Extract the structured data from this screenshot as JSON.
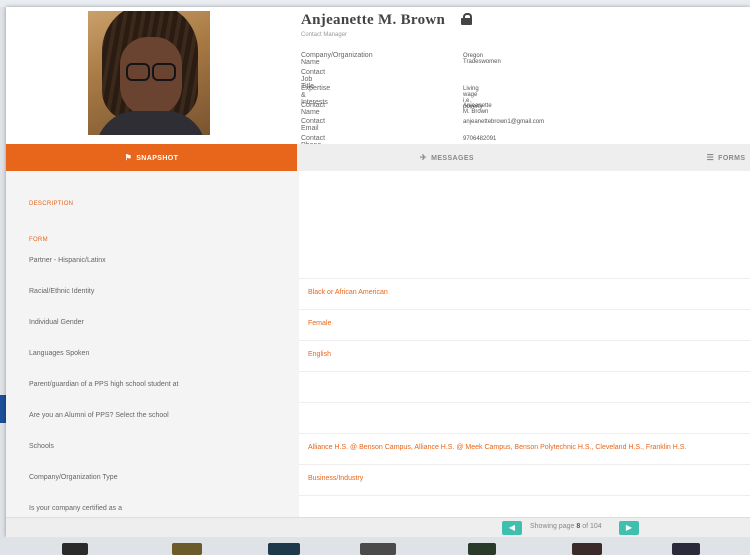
{
  "profile": {
    "name": "Anjeanette M. Brown",
    "role": "Contact Manager",
    "info": [
      {
        "label": "Company/Organization Name",
        "value": "Oregon Tradeswomen"
      },
      {
        "label": "Contact Job Title",
        "value": ""
      },
      {
        "label": "Expertise & Interests",
        "value": "Living wage i.e. poverty"
      },
      {
        "label": "Contact Name",
        "value": "Anjeanette M. Brown"
      },
      {
        "label": "Contact Email",
        "value": "anjeanettebrown1@gmail.com"
      },
      {
        "label": "Contact Phone",
        "value": "9706482091"
      }
    ]
  },
  "tabs": {
    "snapshot": {
      "label": "SNAPSHOT",
      "icon": "⚑"
    },
    "messages": {
      "label": "MESSAGES",
      "icon": "✈"
    },
    "forms": {
      "label": "FORMS",
      "icon": "☰"
    }
  },
  "sections": {
    "description": "DESCRIPTION",
    "form": "FORM"
  },
  "fields": [
    {
      "label": "Partner - Hispanic/Latinx",
      "value": ""
    },
    {
      "label": "Racial/Ethnic Identity",
      "value": "Black or African American"
    },
    {
      "label": "Individual Gender",
      "value": "Female"
    },
    {
      "label": "Languages Spoken",
      "value": "English"
    },
    {
      "label": "Parent/guardian of a PPS high school student at",
      "value": ""
    },
    {
      "label": "Are you an Alumni of PPS? Select the school",
      "value": ""
    },
    {
      "label": "Schools",
      "value": "Alliance H.S. @ Benson Campus, Alliance H.S. @ Meek Campus, Benson Polytechnic H.S., Cleveland H.S., Franklin H.S."
    },
    {
      "label": "Company/Organization Type",
      "value": "Business/Industry"
    },
    {
      "label": "Is your company certified as a",
      "value": ""
    }
  ],
  "pagination": {
    "prev": "◀",
    "next": "▶",
    "prefix": "Showing page",
    "page": "8",
    "separator": "of",
    "total": "104"
  },
  "colors": {
    "accent": "#e8661b",
    "teal": "#3fbfae"
  }
}
